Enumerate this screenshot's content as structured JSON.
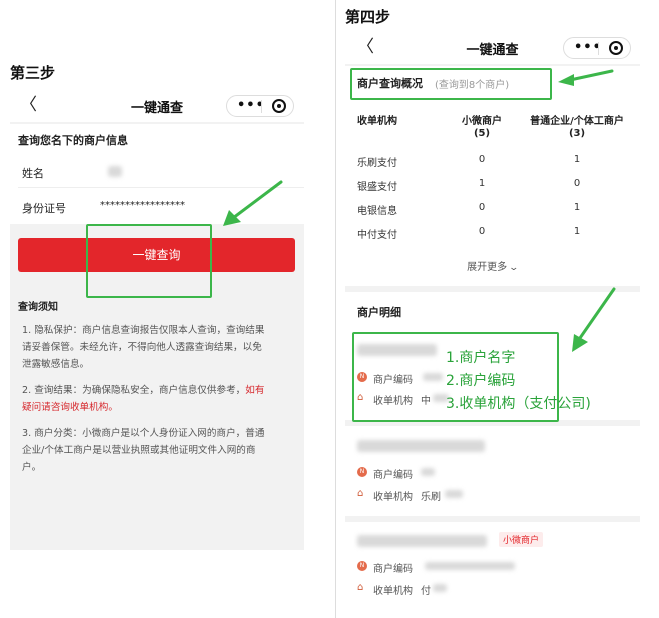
{
  "step3": {
    "label": "第三步",
    "nav": {
      "back": "〈",
      "title": "一键通查",
      "more": "•••"
    },
    "form": {
      "heading": "查询您名下的商户信息",
      "name_label": "姓名",
      "id_label": "身份证号",
      "id_value": "*****************"
    },
    "query_button": "一键查询",
    "notice": {
      "title": "查询须知",
      "p1": [
        "1. 隐私保护：商户信息查询报告仅限本人查询，查询结果",
        "请妥善保管。未经允许，不得向他人透露查询结果，以免",
        "泄露敏感信息。"
      ],
      "p2_a": "2. 查询结果：为确保隐私安全，商户信息仅供参考，",
      "p2_red1": "如有",
      "p2_red2": "疑问请咨询收单机构。",
      "p3": [
        "3. 商户分类：小微商户是以个人身份证入网的商户，普通",
        "企业/个体工商户是以营业执照或其他证明文件入网的商",
        "户。"
      ]
    }
  },
  "step4": {
    "label": "第四步",
    "nav": {
      "back": "〈",
      "title": "一键通查",
      "more": "•••"
    },
    "overview": {
      "title": "商户查询概况",
      "subtitle": "(查询到8个商户)",
      "col_org": "收单机构",
      "col_micro": "小微商户",
      "col_micro_count": "(5)",
      "col_biz": "普通企业/个体工商户",
      "col_biz_count": "(3)",
      "rows": [
        {
          "org": "乐刷支付",
          "micro": "0",
          "biz": "1"
        },
        {
          "org": "银盛支付",
          "micro": "1",
          "biz": "0"
        },
        {
          "org": "电银信息",
          "micro": "0",
          "biz": "1"
        },
        {
          "org": "中付支付",
          "micro": "0",
          "biz": "1"
        }
      ],
      "expand": "展开更多"
    },
    "details": {
      "title": "商户明细",
      "code_label": "商户编码",
      "org_label": "收单机构",
      "items": [
        {
          "org_partial": "中"
        },
        {
          "org_partial": "乐刷"
        },
        {
          "badge": "小微商户",
          "org_partial": "付"
        }
      ]
    },
    "annotations": [
      "1.商户名字",
      "2.商户编码",
      "3.收单机构（支付公司)"
    ]
  },
  "colors": {
    "accent_red": "#e3262b",
    "annotation_green": "#3cb64a"
  },
  "icons": {
    "back": "chevron-left-icon",
    "more": "more-dots-icon",
    "close": "close-circle-icon",
    "code": "tag-icon",
    "org": "bank-icon",
    "expand": "chevron-down-icon"
  }
}
